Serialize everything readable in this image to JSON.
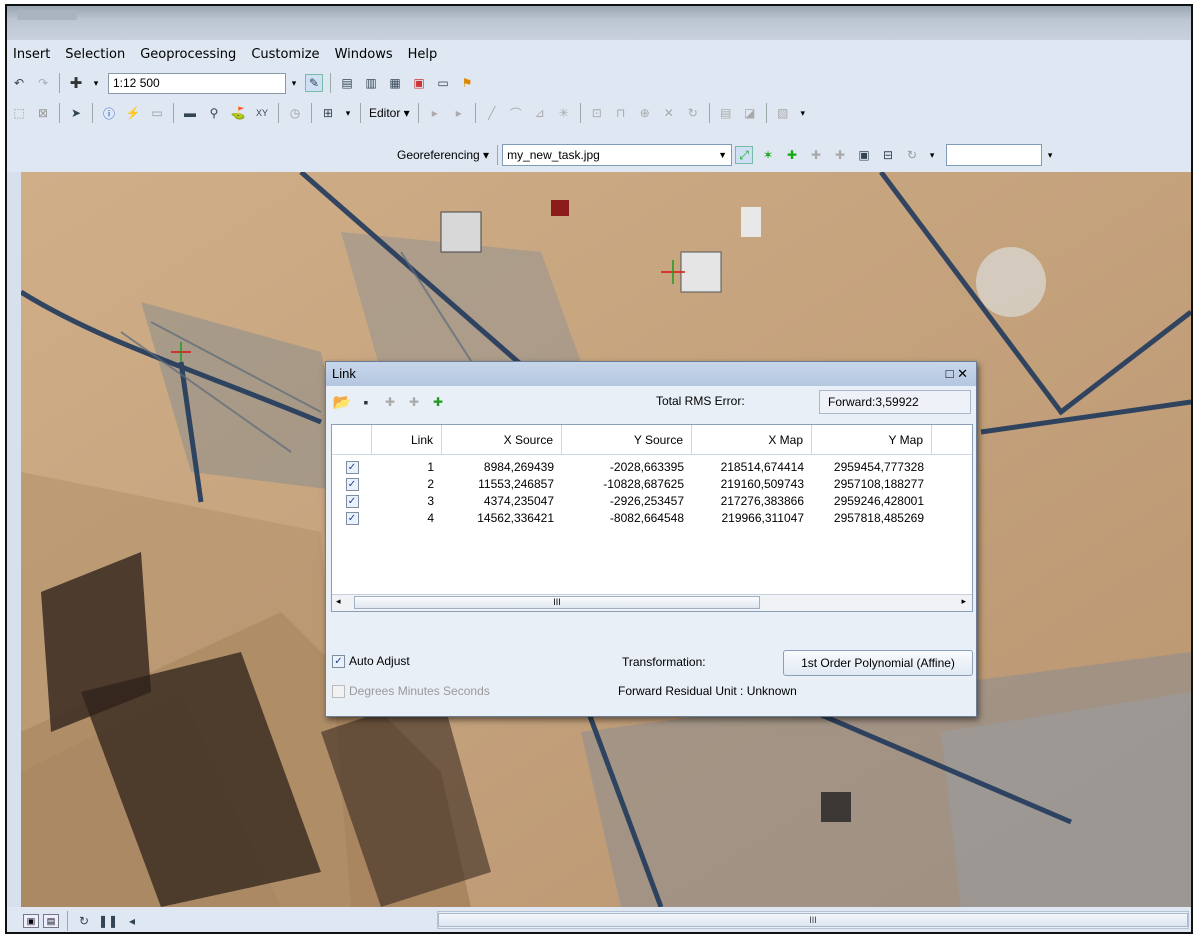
{
  "menu": {
    "items": [
      "Insert",
      "Selection",
      "Geoprocessing",
      "Customize",
      "Windows",
      "Help"
    ]
  },
  "toolbar": {
    "scale": "1:12 500",
    "editor_label": "Editor ▾"
  },
  "georeferencing": {
    "label": "Georeferencing ▾",
    "layer": "my_new_task.jpg",
    "input_value": ""
  },
  "link_dialog": {
    "title": "Link",
    "title_controls": "□ ✕",
    "rms_label": "Total RMS Error:",
    "rms_value": "Forward:3,59922",
    "columns": [
      "",
      "Link",
      "X Source",
      "Y Source",
      "X Map",
      "Y Map"
    ],
    "rows": [
      {
        "checked": true,
        "link": "1",
        "x_source": "8984,269439",
        "y_source": "-2028,663395",
        "x_map": "218514,674414",
        "y_map": "2959454,777328"
      },
      {
        "checked": true,
        "link": "2",
        "x_source": "11553,246857",
        "y_source": "-10828,687625",
        "x_map": "219160,509743",
        "y_map": "2957108,188277"
      },
      {
        "checked": true,
        "link": "3",
        "x_source": "4374,235047",
        "y_source": "-2926,253457",
        "x_map": "217276,383866",
        "y_map": "2959246,428001"
      },
      {
        "checked": true,
        "link": "4",
        "x_source": "14562,336421",
        "y_source": "-8082,664548",
        "x_map": "219966,311047",
        "y_map": "2957818,485269"
      }
    ],
    "scroll_thumb": "III",
    "auto_adjust_label": "Auto Adjust",
    "auto_adjust_checked": true,
    "dms_label": "Degrees Minutes Seconds",
    "transformation_label": "Transformation:",
    "transformation_value": "1st Order Polynomial (Affine)",
    "residual_unit": "Forward Residual Unit : Unknown"
  },
  "statusbar": {
    "scroll_thumb": "III"
  },
  "colors": {
    "link_green": "#1f9a1f",
    "link_red": "#d11",
    "dialog_bg": "#e9eff7",
    "title_bg": "#b4c7e0"
  }
}
